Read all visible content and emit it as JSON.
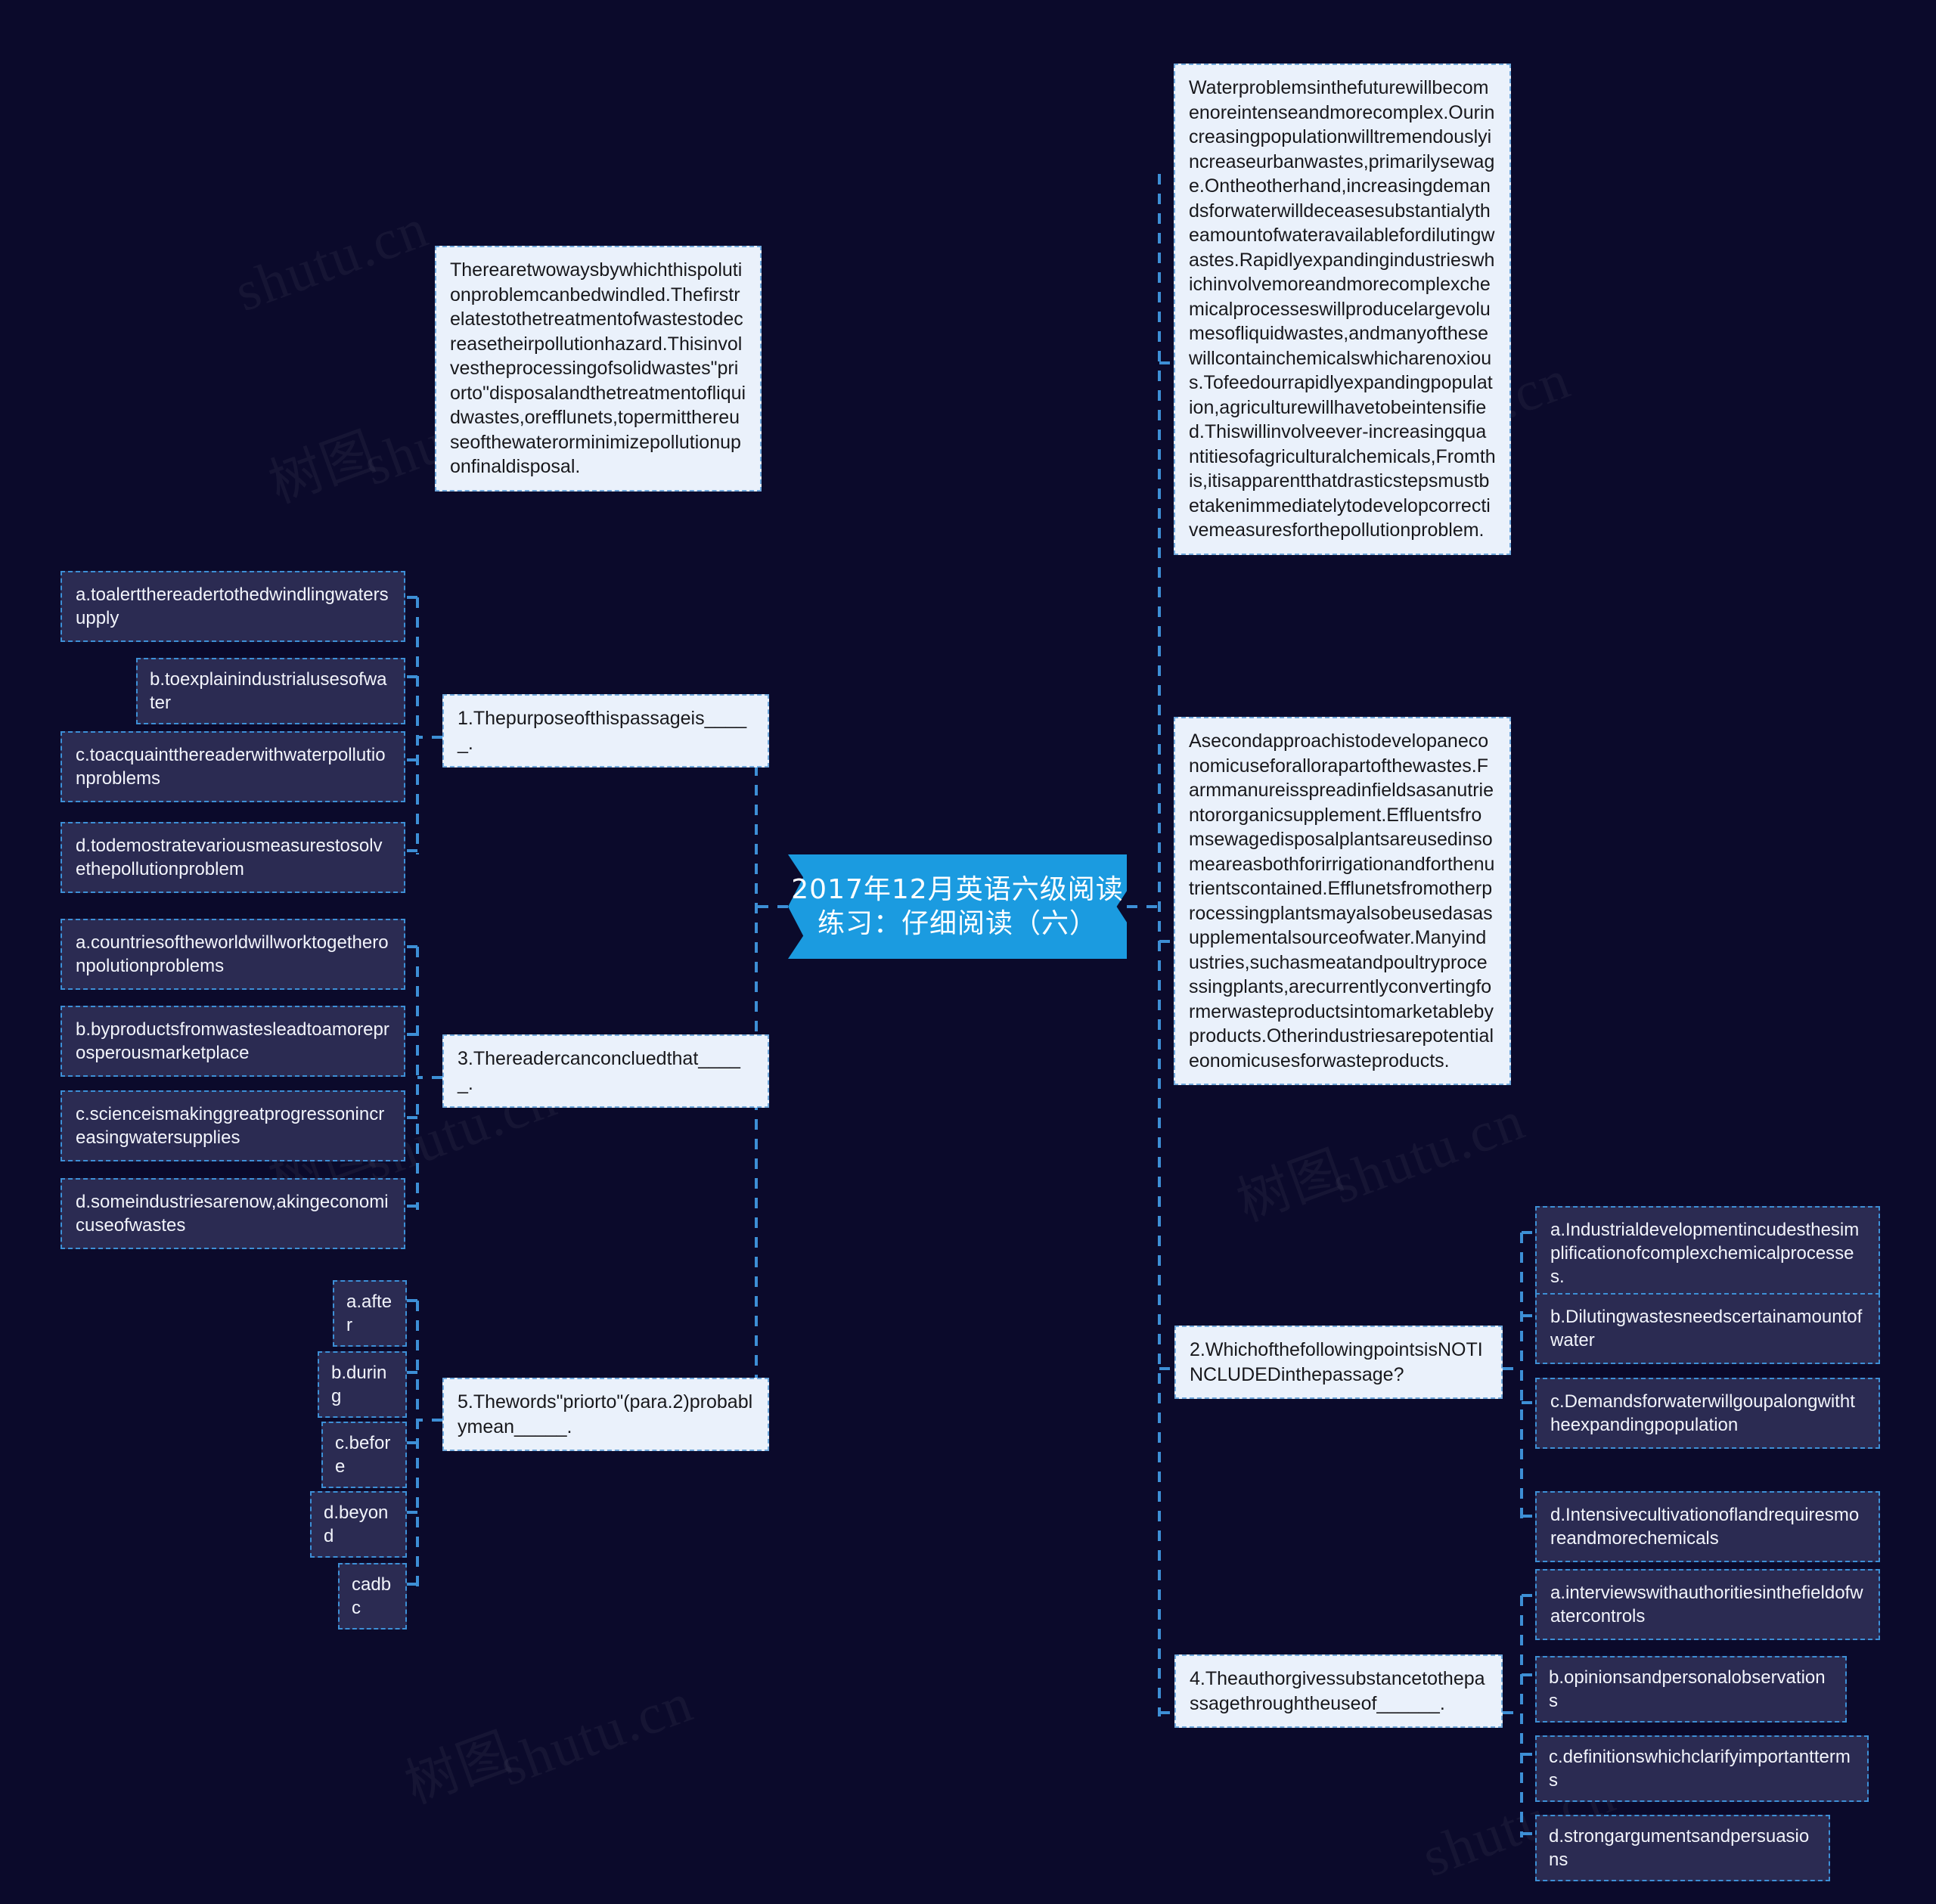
{
  "root": {
    "line1": "2017年12月英语六级阅读",
    "line2": "练习：仔细阅读（六）",
    "accent": "#1b9be0"
  },
  "watermark": {
    "cjk": "树图",
    "latin": "shutu.cn"
  },
  "passages": [
    {
      "id": "passage-1",
      "text": "Waterproblemsinthefuturewillbecomenoreintenseandmorecomplex.Ourincreasingpopulationwilltremendouslyincreaseurbanwastes,primarilysewage.Ontheotherhand,increasingdemandsforwaterwilldeceasesubstantialytheamountofwateravailablefordilutingwastes.Rapidlyexpandingindustrieswhichinvolvemoreandmorecomplexchemicalprocesseswillproducelargevolumesofliquidwastes,andmanyofthesewillcontainchemicalswhicharenoxious.Tofeedourrapidlyexpandingpopulation,agriculturewillhavetobeintensified.Thiswillinvolveever-increasingquantitiesofagriculturalchemicals,Fromthis,itisapparentthatdrasticstepsmustbetakenimmediatelytodevelopcorrectivemeasuresforthepollutionproblem."
    },
    {
      "id": "passage-2",
      "text": "Therearetwowaysbywhichthispolutionproblemcanbedwindled.Thefirstrelatestothetreatmentofwastestodecreasetheirpollutionhazard.Thisinvolvestheprocessingofsolidwastes\"priorto\"disposalandthetreatmentofliquidwastes,orefflunets,topermitthereuseofthewaterorminimizepollutionuponfinaldisposal."
    },
    {
      "id": "passage-3",
      "text": "Asecondapproachistodevelopaneconomicuseforallorapartofthewastes.Farmmanureisspreadinfieldsasanutrientororganicsupplement.Effluentsfromsewagedisposalplantsareusedinsomeareasbothforirrigationandforthenutrientscontained.Efflunetsfromotherprocessingplantsmayalsobeusedasasupplementalsourceofwater.Manyindustries,suchasmeatandpoultryprocessingplants,arecurrentlyconvertingformerwasteproductsintomarketablebyproducts.Otherindustriesarepotentialeonomicusesforwasteproducts."
    }
  ],
  "questions": [
    {
      "id": "q1",
      "text": "1.Thepurposeofthispassageis_____.",
      "options": [
        "a.toalertthereadertothedwindlingwatersupply",
        "b.toexplainindustrialusesofwater",
        "c.toacquaintthereaderwithwaterpollutionproblems",
        "d.todemostratevariousmeasurestosolvethepollutionproblem"
      ]
    },
    {
      "id": "q3",
      "text": "3.Thereadercanconcluedthat_____.",
      "options": [
        "a.countriesoftheworldwillworktogetheronpolutionproblems",
        "b.byproductsfromwastesleadtoamoreprosperousmarketplace",
        "c.scienceismakinggreatprogressonincreasingwatersupplies",
        "d.someindustriesarenow,akingeconomicuseofwastes"
      ]
    },
    {
      "id": "q5",
      "text": "5.Thewords\"priorto\"(para.2)probablymean_____.",
      "options": [
        "a.after",
        "b.during",
        "c.before",
        "d.beyond",
        "cadbc"
      ]
    },
    {
      "id": "q2",
      "text": "2.WhichofthefollowingpointsisNOTINCLUDEDinthepassage?",
      "options": [
        "a.Industrialdevelopmentincudesthesimplificationofcomplexchemicalprocesses.",
        "b.Dilutingwastesneedscertainamountofwater",
        "c.Demandsforwaterwillgoupalongwiththeexpandingpopulation",
        "d.Intensivecultivationoflandrequiresmoreandmorechemicals"
      ]
    },
    {
      "id": "q4",
      "text": "4.Theauthorgivessubstancetothepassagethroughtheuseof______.",
      "options": [
        "a.interviewswithauthoritiesinthefieldofwatercontrols",
        "b.opinionsandpersonalobservations",
        "c.definitionswhichclarifyimportantterms",
        "d.strongargumentsandpersuasions"
      ]
    }
  ]
}
